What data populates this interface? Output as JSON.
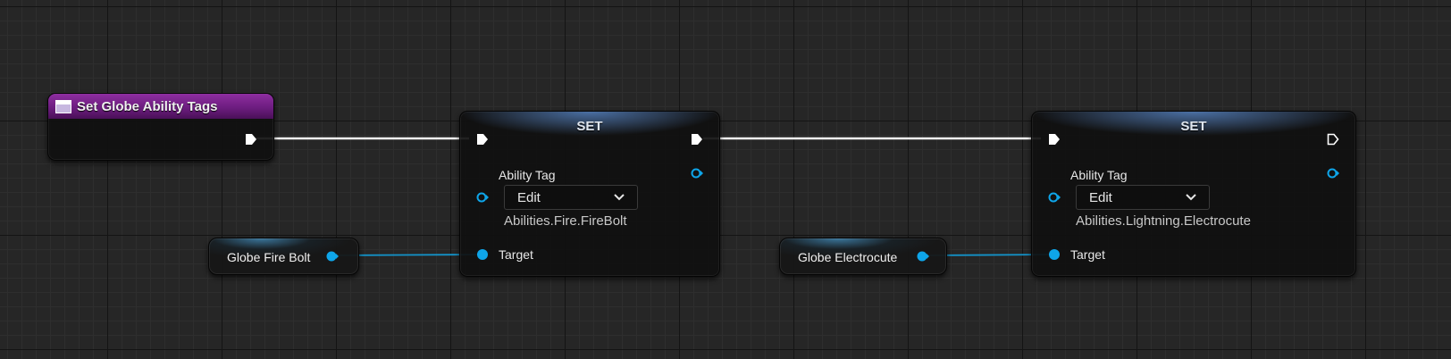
{
  "colors": {
    "exec_wire": "#ffffff",
    "object_pin": "#0ea5e9",
    "object_wire": "#1393c9",
    "event_header": "#7a2090",
    "set_header": "#3b5a85"
  },
  "event_node": {
    "icon": "event-icon",
    "title": "Set Globe Ability Tags"
  },
  "set_nodes": [
    {
      "title": "SET",
      "field_label": "Ability Tag",
      "dropdown_value": "Edit",
      "tag_value": "Abilities.Fire.FireBolt",
      "target_label": "Target"
    },
    {
      "title": "SET",
      "field_label": "Ability Tag",
      "dropdown_value": "Edit",
      "tag_value": "Abilities.Lightning.Electrocute",
      "target_label": "Target"
    }
  ],
  "variable_nodes": [
    {
      "label": "Globe Fire Bolt"
    },
    {
      "label": "Globe Electrocute"
    }
  ]
}
